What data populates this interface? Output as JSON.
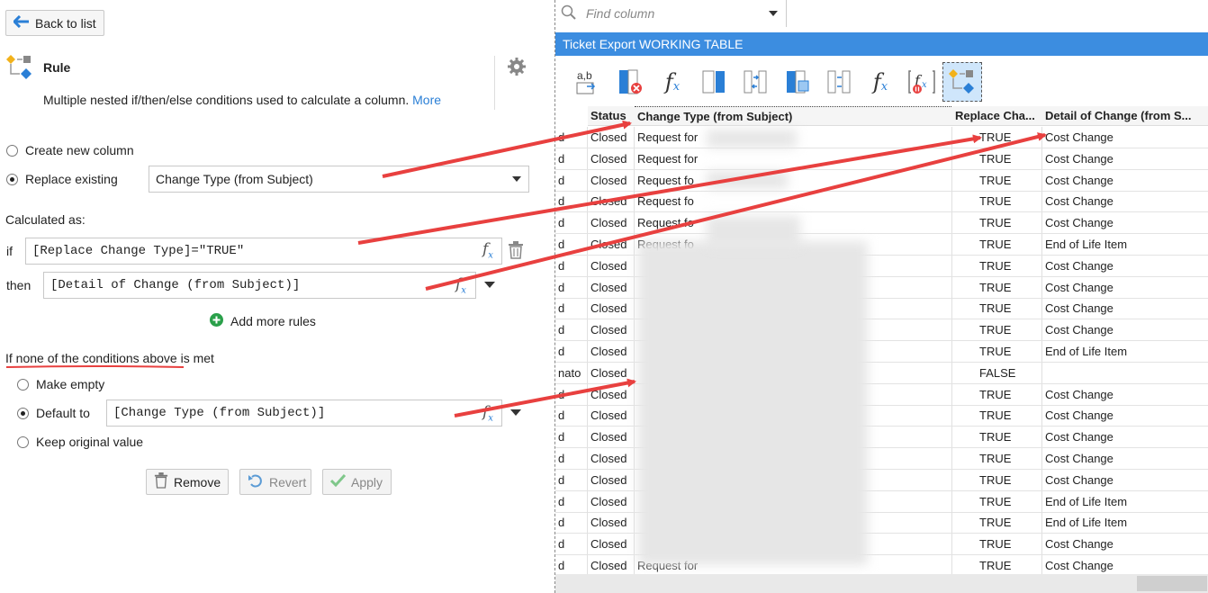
{
  "left": {
    "back_label": "Back to list",
    "rule_title": "Rule",
    "rule_desc": "Multiple nested if/then/else conditions used to calculate a column.",
    "more_link": "More",
    "create_new": "Create new column",
    "replace_existing": "Replace existing",
    "replace_value": "Change Type (from Subject)",
    "calculated_as": "Calculated as:",
    "if_label": "if",
    "if_expr": "[Replace Change Type]=\"TRUE\"",
    "then_label": "then",
    "then_expr": "[Detail of Change (from Subject)]",
    "add_rules": "Add more rules",
    "none_label": "If none of the conditions above is met",
    "make_empty": "Make empty",
    "default_to": "Default to",
    "default_expr": "[Change Type (from Subject)]",
    "keep_original": "Keep original value",
    "remove_label": "Remove",
    "revert_label": "Revert",
    "apply_label": "Apply"
  },
  "right": {
    "find_placeholder": "Find column",
    "table_title": "Ticket Export WORKING TABLE",
    "columns": [
      "Status",
      "Change Type (from Subject)",
      "Replace Cha...",
      "Detail of Change (from S..."
    ],
    "rows": [
      {
        "lead": "d",
        "status": "Closed",
        "change": "Request for",
        "replace": "TRUE",
        "detail": "Cost Change"
      },
      {
        "lead": "d",
        "status": "Closed",
        "change": "Request for",
        "replace": "TRUE",
        "detail": "Cost Change"
      },
      {
        "lead": "d",
        "status": "Closed",
        "change": "Request fo",
        "replace": "TRUE",
        "detail": "Cost Change"
      },
      {
        "lead": "d",
        "status": "Closed",
        "change": "Request fo",
        "replace": "TRUE",
        "detail": "Cost Change"
      },
      {
        "lead": "d",
        "status": "Closed",
        "change": "Request fo",
        "replace": "TRUE",
        "detail": "Cost Change"
      },
      {
        "lead": "d",
        "status": "Closed",
        "change": "Request fo",
        "replace": "TRUE",
        "detail": "End of Life Item"
      },
      {
        "lead": "d",
        "status": "Closed",
        "change": "",
        "replace": "TRUE",
        "detail": "Cost Change"
      },
      {
        "lead": "d",
        "status": "Closed",
        "change": "",
        "replace": "TRUE",
        "detail": "Cost Change"
      },
      {
        "lead": "d",
        "status": "Closed",
        "change": "",
        "replace": "TRUE",
        "detail": "Cost Change"
      },
      {
        "lead": "d",
        "status": "Closed",
        "change": "",
        "replace": "TRUE",
        "detail": "Cost Change"
      },
      {
        "lead": "d",
        "status": "Closed",
        "change": "",
        "replace": "TRUE",
        "detail": "End of Life Item"
      },
      {
        "lead": "nato",
        "status": "Closed",
        "change": "",
        "replace": "FALSE",
        "detail": ""
      },
      {
        "lead": "d",
        "status": "Closed",
        "change": "",
        "replace": "TRUE",
        "detail": "Cost Change"
      },
      {
        "lead": "d",
        "status": "Closed",
        "change": "",
        "replace": "TRUE",
        "detail": "Cost Change"
      },
      {
        "lead": "d",
        "status": "Closed",
        "change": "",
        "replace": "TRUE",
        "detail": "Cost Change"
      },
      {
        "lead": "d",
        "status": "Closed",
        "change": "",
        "replace": "TRUE",
        "detail": "Cost Change"
      },
      {
        "lead": "d",
        "status": "Closed",
        "change": "",
        "replace": "TRUE",
        "detail": "Cost Change"
      },
      {
        "lead": "d",
        "status": "Closed",
        "change": "",
        "replace": "TRUE",
        "detail": "End of Life Item"
      },
      {
        "lead": "d",
        "status": "Closed",
        "change": "",
        "replace": "TRUE",
        "detail": "End of Life Item"
      },
      {
        "lead": "d",
        "status": "Closed",
        "change": "",
        "replace": "TRUE",
        "detail": "Cost Change"
      },
      {
        "lead": "d",
        "status": "Closed",
        "change": "Request for",
        "replace": "TRUE",
        "detail": "Cost Change"
      }
    ]
  },
  "colors": {
    "accent": "#3c8de0",
    "annotation": "#e8403f",
    "link": "#2a7fd6",
    "add_green": "#2aa04a"
  },
  "icons": [
    "back-arrow-icon",
    "rule-icon",
    "gear-icon",
    "trash-icon",
    "fx-icon",
    "plus-circle-icon",
    "revert-icon",
    "check-icon",
    "search-icon"
  ]
}
